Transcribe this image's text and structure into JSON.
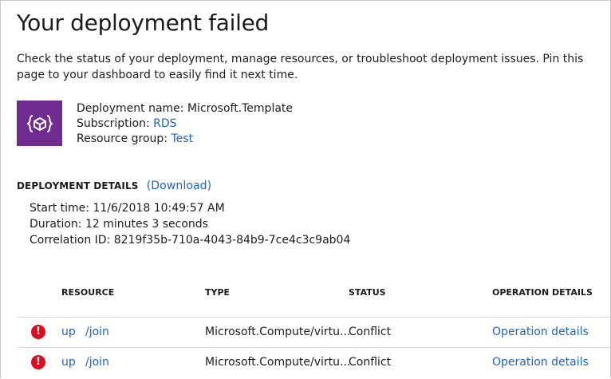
{
  "page": {
    "title": "Your deployment failed",
    "intro": "Check the status of your deployment, manage resources, or troubleshoot deployment issues. Pin this page to your dashboard to easily find it next time."
  },
  "deployment": {
    "icon": "template-braces-icon",
    "name_label": "Deployment name:",
    "name_value": "Microsoft.Template",
    "subscription_label": "Subscription:",
    "subscription_value": "RDS",
    "resource_group_label": "Resource group:",
    "resource_group_value": "Test"
  },
  "details": {
    "heading": "DEPLOYMENT DETAILS",
    "download_link": "(Download)",
    "start_time_label": "Start time:",
    "start_time_value": "11/6/2018 10:49:57 AM",
    "duration_label": "Duration:",
    "duration_value": "12 minutes 3 seconds",
    "correlation_label": "Correlation ID:",
    "correlation_value": "8219f35b-710a-4043-84b9-7ce4c3c9ab04"
  },
  "table": {
    "headers": [
      "RESOURCE",
      "TYPE",
      "STATUS",
      "OPERATION DETAILS"
    ],
    "rows": [
      {
        "status_icon": "error-icon",
        "resource_a": "up",
        "resource_b": "/join",
        "type": "Microsoft.Compute/virtu...",
        "status": "Conflict",
        "operation": "Operation details"
      },
      {
        "status_icon": "error-icon",
        "resource_a": "up",
        "resource_b": "/join",
        "type": "Microsoft.Compute/virtu...",
        "status": "Conflict",
        "operation": "Operation details"
      }
    ]
  },
  "colors": {
    "accent_link": "#1a63c7",
    "tile_purple": "#6f2b8f",
    "error_red": "#e00b1c"
  }
}
